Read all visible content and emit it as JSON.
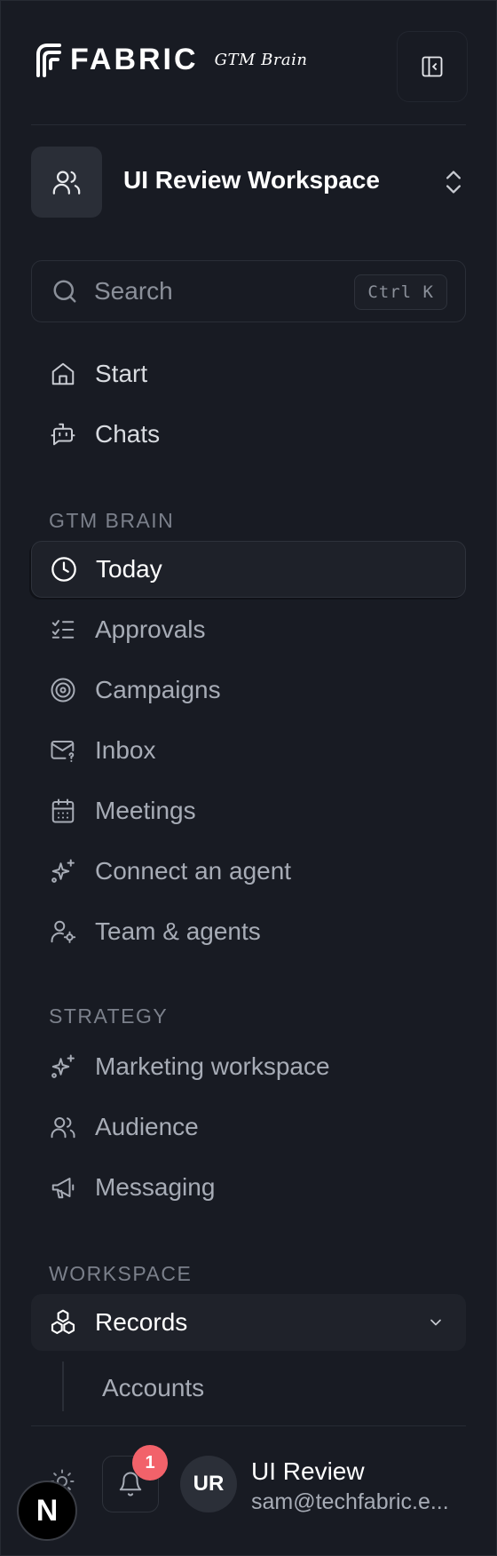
{
  "brand": {
    "name": "FABRIC",
    "tagline": "GTM Brain"
  },
  "workspace": {
    "name": "UI Review Workspace"
  },
  "search": {
    "placeholder": "Search",
    "shortcut": "Ctrl K"
  },
  "nav_top": [
    {
      "label": "Start",
      "icon": "home-icon"
    },
    {
      "label": "Chats",
      "icon": "bot-icon"
    }
  ],
  "sections": {
    "gtm_brain": "GTM BRAIN",
    "strategy": "STRATEGY",
    "workspace": "WORKSPACE"
  },
  "gtm_items": [
    {
      "label": "Today",
      "icon": "clock-icon",
      "active": true
    },
    {
      "label": "Approvals",
      "icon": "checklist-icon"
    },
    {
      "label": "Campaigns",
      "icon": "target-icon"
    },
    {
      "label": "Inbox",
      "icon": "mail-question-icon"
    },
    {
      "label": "Meetings",
      "icon": "calendar-icon"
    },
    {
      "label": "Connect an agent",
      "icon": "sparkles-icon"
    },
    {
      "label": "Team & agents",
      "icon": "user-cog-icon"
    }
  ],
  "strategy_items": [
    {
      "label": "Marketing workspace",
      "icon": "sparkles-icon"
    },
    {
      "label": "Audience",
      "icon": "users-icon"
    },
    {
      "label": "Messaging",
      "icon": "megaphone-icon"
    }
  ],
  "workspace_items": {
    "records": {
      "label": "Records",
      "icon": "boxes-icon",
      "expanded": true
    },
    "accounts": {
      "label": "Accounts"
    }
  },
  "footer": {
    "notification_count": "1",
    "user_initials": "UR",
    "user_name": "UI Review",
    "user_email": "sam@techfabric.e...",
    "dev_badge": "N"
  },
  "colors": {
    "background": "#181b23",
    "accent_badge": "#f2626a",
    "active_bg": "#1e2129"
  }
}
